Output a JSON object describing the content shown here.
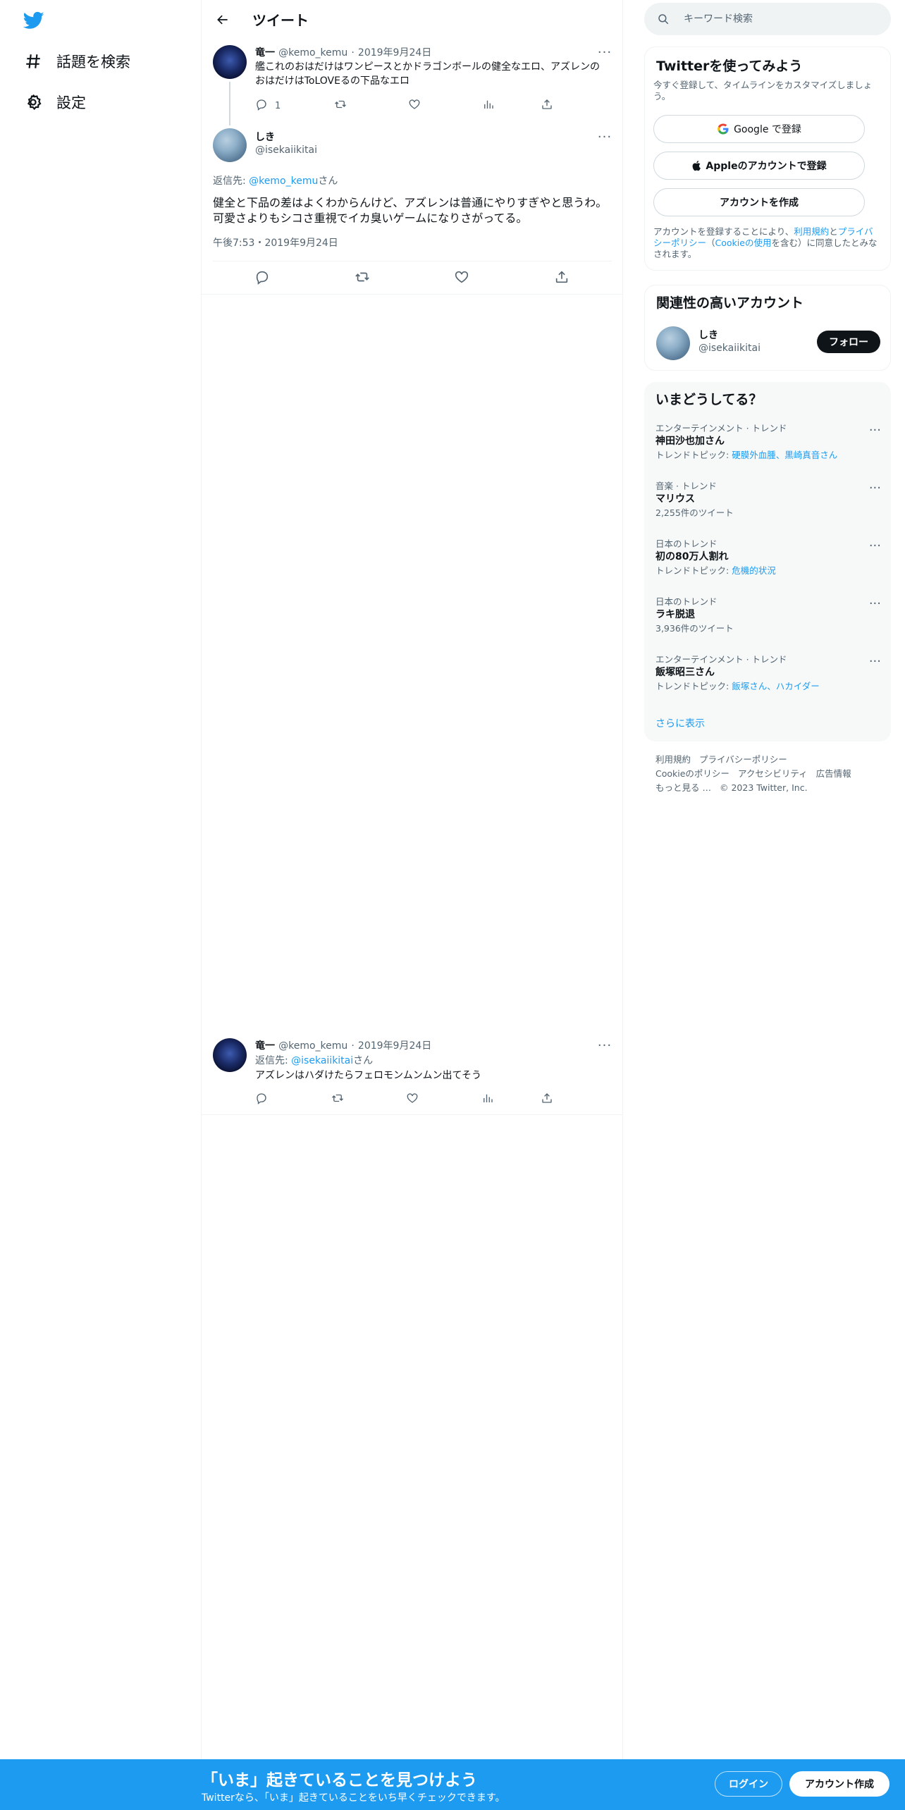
{
  "nav": {
    "logo_icon": "twitter-bird-icon",
    "items": [
      {
        "label": "話題を検索",
        "icon": "hashtag-icon"
      },
      {
        "label": "設定",
        "icon": "gear-icon"
      }
    ]
  },
  "header": {
    "title": "ツイート",
    "back_icon": "back-arrow-icon"
  },
  "parent_tweet": {
    "name": "竜一",
    "handle": "@kemo_kemu",
    "separator": "·",
    "date": "2019年9月24日",
    "text": "艦これのおはだけはワンピースとかドラゴンボールの健全なエロ、アズレンのおはだけはToLOVEるの下品なエロ",
    "reply_count": "1"
  },
  "main_tweet": {
    "name": "しき",
    "handle": "@isekaiikitai",
    "reply_prefix": "返信先: ",
    "reply_to": "@kemo_kemu",
    "reply_suffix": "さん",
    "text": "健全と下品の差はよくわからんけど、アズレンは普通にやりすぎやと思うわ。可愛さよりもシコさ重視でイカ臭いゲームになりさがってる。",
    "timestamp": "午後7:53・2019年9月24日"
  },
  "reply_tweet": {
    "name": "竜一",
    "handle": "@kemo_kemu",
    "separator": "·",
    "date": "2019年9月24日",
    "reply_prefix": "返信先: ",
    "reply_to": "@isekaiikitai",
    "reply_suffix": "さん",
    "text": "アズレンはハダけたらフェロモンムンムン出てそう"
  },
  "search": {
    "placeholder": "キーワード検索"
  },
  "signup_card": {
    "title": "Twitterを使ってみよう",
    "subtitle": "今すぐ登録して、タイムラインをカスタマイズしましょう。",
    "google_label": "Google で登録",
    "apple_label": "Appleのアカウントで登録",
    "create_label": "アカウントを作成",
    "terms_prefix": "アカウントを登録することにより、",
    "terms_link1": "利用規約",
    "terms_and": "と",
    "terms_link2": "プライバシーポリシー",
    "terms_paren_open": "（",
    "terms_link3": "Cookieの使用",
    "terms_suffix": "を含む）に同意したとみなされます。"
  },
  "related": {
    "title": "関連性の高いアカウント",
    "name": "しき",
    "handle": "@isekaiikitai",
    "follow_label": "フォロー"
  },
  "trends": {
    "title": "いまどうしてる？",
    "items": [
      {
        "category": "エンターテインメント · トレンド",
        "title": "神田沙也加さん",
        "sub_prefix": "トレンドトピック: ",
        "sub_link": "硬膜外血腫、黒崎真音さん"
      },
      {
        "category": "音楽 · トレンド",
        "title": "マリウス",
        "sub_prefix": "2,255件のツイート",
        "sub_link": ""
      },
      {
        "category": "日本のトレンド",
        "title": "初の80万人割れ",
        "sub_prefix": "トレンドトピック: ",
        "sub_link": "危機的状況"
      },
      {
        "category": "日本のトレンド",
        "title": "ラキ脱退",
        "sub_prefix": "3,936件のツイート",
        "sub_link": ""
      },
      {
        "category": "エンターテインメント · トレンド",
        "title": "飯塚昭三さん",
        "sub_prefix": "トレンドトピック: ",
        "sub_link": "飯塚さん、ハカイダー"
      }
    ],
    "show_more": "さらに表示"
  },
  "footer": {
    "line1": [
      "利用規約",
      "プライバシーポリシー"
    ],
    "line2": [
      "Cookieのポリシー",
      "アクセシビリティ",
      "広告情報"
    ],
    "more": "もっと見る …",
    "copyright": "© 2023 Twitter, Inc."
  },
  "banner": {
    "title": "「いま」起きていることを見つけよう",
    "subtitle": "Twitterなら、「いま」起きていることをいち早くチェックできます。",
    "login_label": "ログイン",
    "signup_label": "アカウント作成"
  },
  "colors": {
    "brand": "#1d9bf0",
    "text": "#0f1419",
    "muted": "#536471"
  }
}
